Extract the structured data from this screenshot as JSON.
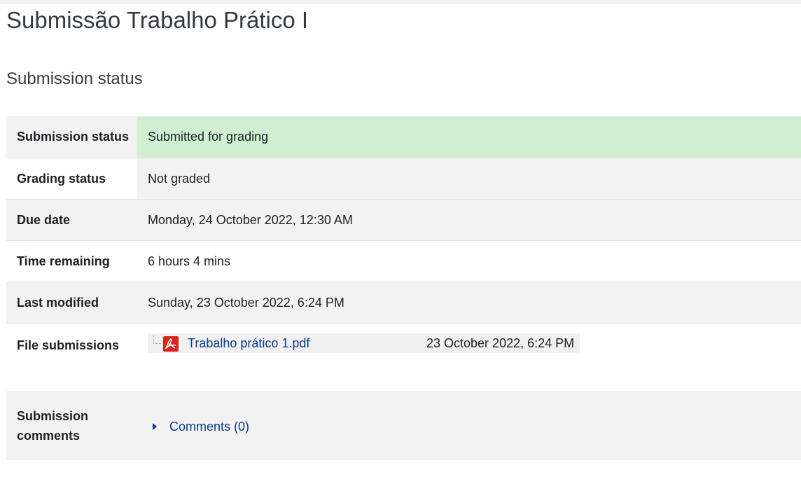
{
  "page": {
    "title": "Submissão Trabalho Prático I",
    "section_heading": "Submission status"
  },
  "status_table": {
    "rows": [
      {
        "label": "Submission status",
        "value": "Submitted for grading"
      },
      {
        "label": "Grading status",
        "value": "Not graded"
      },
      {
        "label": "Due date",
        "value": "Monday, 24 October 2022, 12:30 AM"
      },
      {
        "label": "Time remaining",
        "value": "6 hours 4 mins"
      },
      {
        "label": "Last modified",
        "value": "Sunday, 23 October 2022, 6:24 PM"
      },
      {
        "label": "File submissions",
        "value": ""
      },
      {
        "label": "Submission comments",
        "value": ""
      }
    ],
    "file": {
      "name": "Trabalho prático 1.pdf",
      "date": "23 October 2022, 6:24 PM",
      "icon": "pdf-icon"
    },
    "comments": {
      "label": "Comments (0)"
    }
  },
  "colors": {
    "submitted_bg": "#cfefd0",
    "stripe_bg": "#f2f2f2",
    "link": "#0f3a87"
  }
}
